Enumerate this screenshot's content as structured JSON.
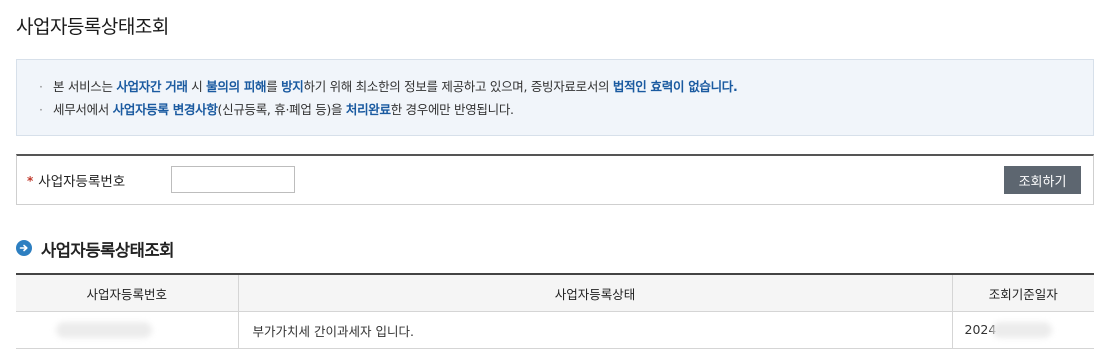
{
  "page": {
    "title": "사업자등록상태조회"
  },
  "notice": {
    "line1": [
      {
        "text": "본 서비스는 ",
        "hl": false
      },
      {
        "text": "사업자간 거래",
        "hl": true
      },
      {
        "text": " 시 ",
        "hl": false
      },
      {
        "text": "불의의 피해",
        "hl": true
      },
      {
        "text": "를 ",
        "hl": false
      },
      {
        "text": "방지",
        "hl": true
      },
      {
        "text": "하기 위해 최소한의 정보를 제공하고 있으며, 증빙자료로서의 ",
        "hl": false
      },
      {
        "text": "법적인 효력이 없습니다.",
        "hl": true
      }
    ],
    "line2": [
      {
        "text": "세무서에서 ",
        "hl": false
      },
      {
        "text": "사업자등록 변경사항",
        "hl": true
      },
      {
        "text": "(신규등록, 휴·폐업 등)을 ",
        "hl": false
      },
      {
        "text": "처리완료",
        "hl": true
      },
      {
        "text": "한 경우에만 반영됩니다.",
        "hl": false
      }
    ]
  },
  "search": {
    "required_mark": "*",
    "label": "사업자등록번호",
    "input_value": "",
    "button_label": "조회하기"
  },
  "result": {
    "section_title": "사업자등록상태조회",
    "columns": [
      "사업자등록번호",
      "사업자등록상태",
      "조회기준일자"
    ],
    "row": {
      "status": "부가가치세 간이과세자 입니다.",
      "date_prefix": "2024"
    }
  },
  "colors": {
    "highlight": "#1a5aa0",
    "button": "#5d6670",
    "section_icon": "#2d7fc1",
    "required": "#c0392b"
  },
  "icons": {
    "section": "arrow-circle-icon"
  }
}
